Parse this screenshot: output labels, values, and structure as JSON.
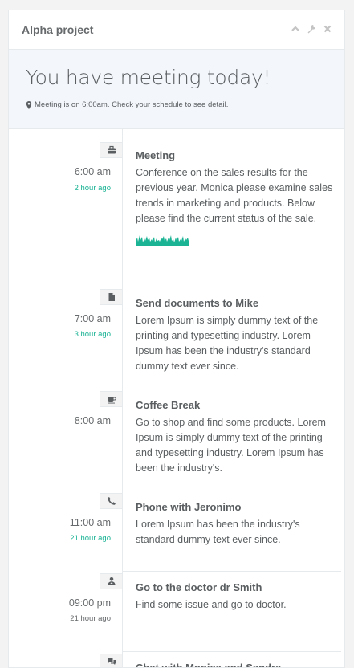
{
  "panel": {
    "title": "Alpha project",
    "tools": [
      "chevron-up-icon",
      "wrench-icon",
      "close-icon"
    ]
  },
  "banner": {
    "heading": "You have meeting today!",
    "subtext": "Meeting is on 6:00am. Check your schedule to see detail."
  },
  "accent_color": "#1ab394",
  "timeline": [
    {
      "icon": "briefcase-icon",
      "time": "6:00 am",
      "ago": "2 hour ago",
      "ago_color": "green",
      "title": "Meeting",
      "text": "Conference on the sales results for the previous year. Monica please examine sales trends in marketing and products. Below please find the current status of the sale.",
      "has_sparkline": true
    },
    {
      "icon": "document-icon",
      "time": "7:00 am",
      "ago": "3 hour ago",
      "ago_color": "green",
      "title": "Send documents to Mike",
      "text": "Lorem Ipsum is simply dummy text of the printing and typesetting industry. Lorem Ipsum has been the industry's standard dummy text ever since."
    },
    {
      "icon": "coffee-icon",
      "time": "8:00 am",
      "ago": "",
      "title": "Coffee Break",
      "text": "Go to shop and find some products. Lorem Ipsum is simply dummy text of the printing and typesetting industry. Lorem Ipsum has been the industry's."
    },
    {
      "icon": "phone-icon",
      "time": "11:00 am",
      "ago": "21 hour ago",
      "ago_color": "green",
      "title": "Phone with Jeronimo",
      "text": "Lorem Ipsum has been the industry's standard dummy text ever since."
    },
    {
      "icon": "user-md-icon",
      "time": "09:00 pm",
      "ago": "21 hour ago",
      "ago_color": "gray",
      "title": "Go to the doctor dr Smith",
      "text": "Find some issue and go to doctor."
    },
    {
      "icon": "comments-icon",
      "time": "",
      "ago": "",
      "title": "Chat with Monica and Sandra",
      "text": ""
    }
  ]
}
